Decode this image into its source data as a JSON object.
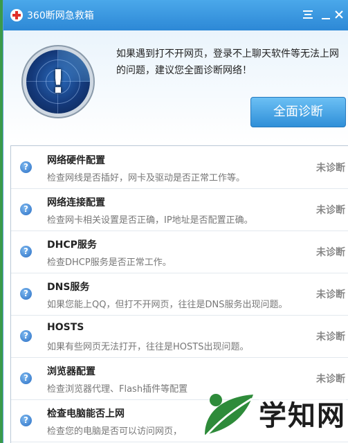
{
  "window": {
    "title": "360断网急救箱"
  },
  "header": {
    "intro_text": "如果遇到打不开网页，登录不上聊天软件等无法上网的问题，建议您全面诊断网络！",
    "diagnose_button": "全面诊断"
  },
  "items": [
    {
      "title": "网络硬件配置",
      "desc": "检查网线是否插好，网卡及驱动是否正常工作等。",
      "status": "未诊断"
    },
    {
      "title": "网络连接配置",
      "desc": "检查网卡相关设置是否正确，IP地址是否配置正确。",
      "status": "未诊断"
    },
    {
      "title": "DHCP服务",
      "desc": "检查DHCP服务是否正常工作。",
      "status": "未诊断"
    },
    {
      "title": "DNS服务",
      "desc": "如果您能上QQ，但打不开网页，往往是DNS服务出现问题。",
      "status": "未诊断"
    },
    {
      "title": "HOSTS",
      "desc": "如果有些网页无法打开，往往是HOSTS出现问题。",
      "status": "未诊断"
    },
    {
      "title": "浏览器配置",
      "desc": "检查浏览器代理、Flash插件等配置",
      "status": "未诊断"
    },
    {
      "title": "检查电脑能否上网",
      "desc": "检查您的电脑是否可以访问网页，",
      "status": ""
    }
  ],
  "icons": {
    "app": "first-aid-cross-icon",
    "radar": "radar-alert-icon",
    "item": "question-icon",
    "menu": "menu-icon",
    "minimize": "minimize-icon",
    "close": "close-icon"
  },
  "watermark": {
    "text": "学知网"
  },
  "colors": {
    "titlebar": "#2d88d6",
    "button": "#2f8fd8",
    "status": "#888888",
    "brand_red": "#e0302a",
    "watermark_green": "#2e8b3a"
  }
}
